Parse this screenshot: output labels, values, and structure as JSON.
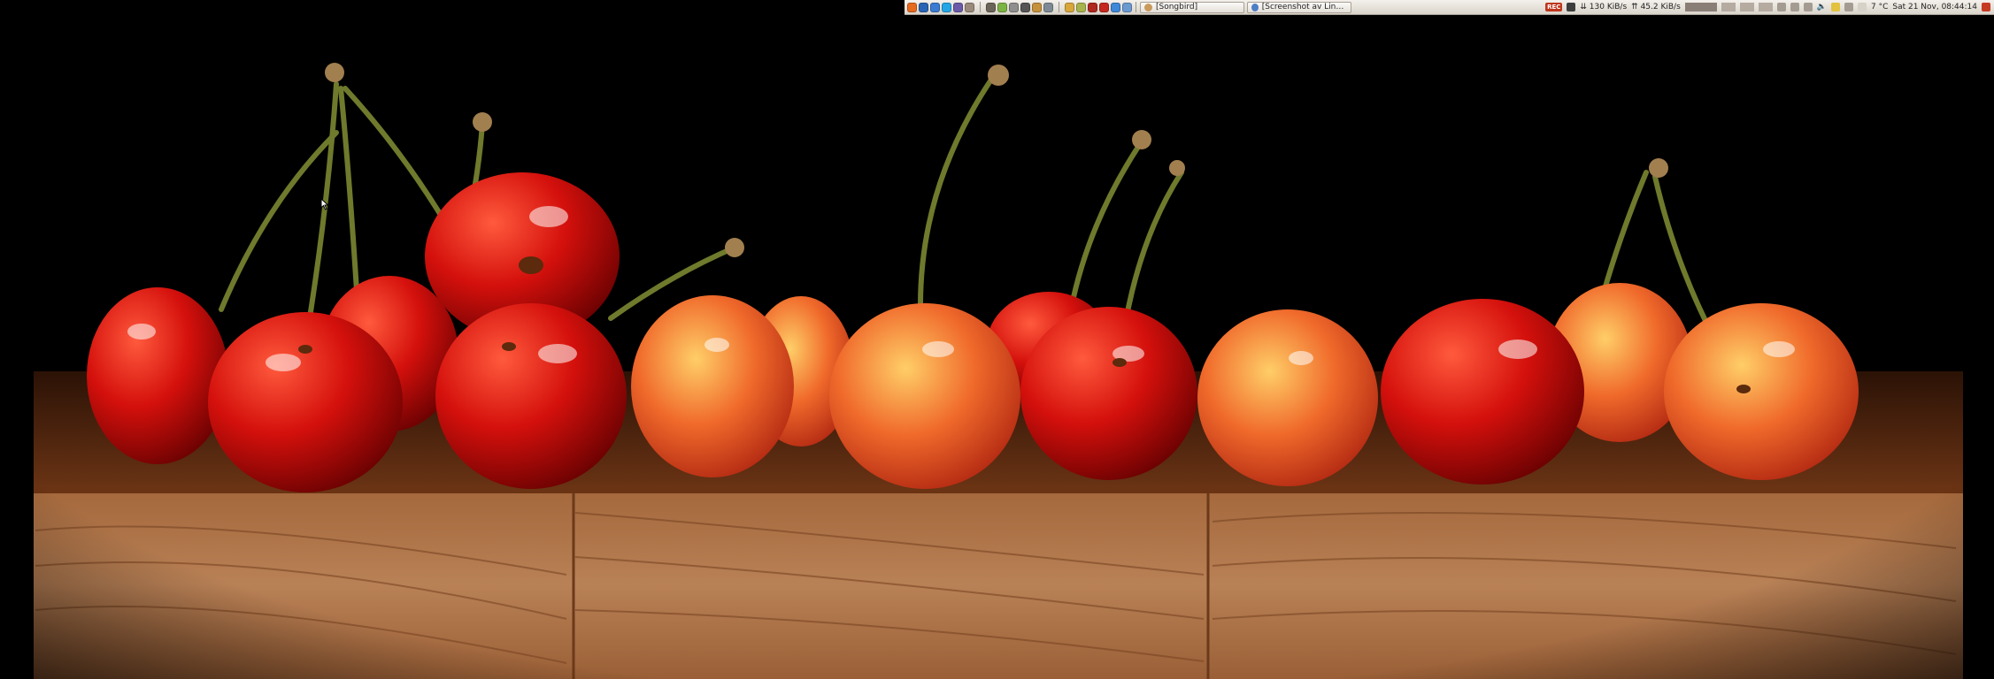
{
  "taskbar": {
    "launcher_icons": [
      "firefox-icon",
      "globe-icon",
      "thunderbird-icon",
      "skype-icon",
      "media-icon",
      "user-icon",
      "file-manager-icon",
      "chat-icon",
      "settings-icon",
      "terminal-icon",
      "archive-icon",
      "calculator-icon",
      "folder-icon",
      "image-viewer-icon",
      "video-icon",
      "opera-icon",
      "chrome-icon",
      "browser-icon"
    ],
    "launcher_colors": [
      "#e66a1f",
      "#2a64b4",
      "#3b7bd1",
      "#24a6e6",
      "#6a5aa8",
      "#9a8a7c",
      "#6b6458",
      "#7cb342",
      "#8e8e8e",
      "#555555",
      "#c6913b",
      "#7d8a96",
      "#d8a73a",
      "#a7b34d",
      "#b0281f",
      "#c6281e",
      "#3f88d8",
      "#6a9ad0"
    ],
    "windows": [
      {
        "title": "[Songbird]",
        "icon": "songbird-icon",
        "color": "#c99a5a"
      },
      {
        "title": "[Screenshot av Linux-d...",
        "icon": "screenshot-icon",
        "color": "#4f7ec6"
      }
    ]
  },
  "tray": {
    "recording_badge": "REC",
    "download_rate": "130 KiB/s",
    "upload_rate": "45.2 KiB/s",
    "temperature": "7 °C",
    "clock": "Sat 21 Nov, 08:44:14"
  }
}
